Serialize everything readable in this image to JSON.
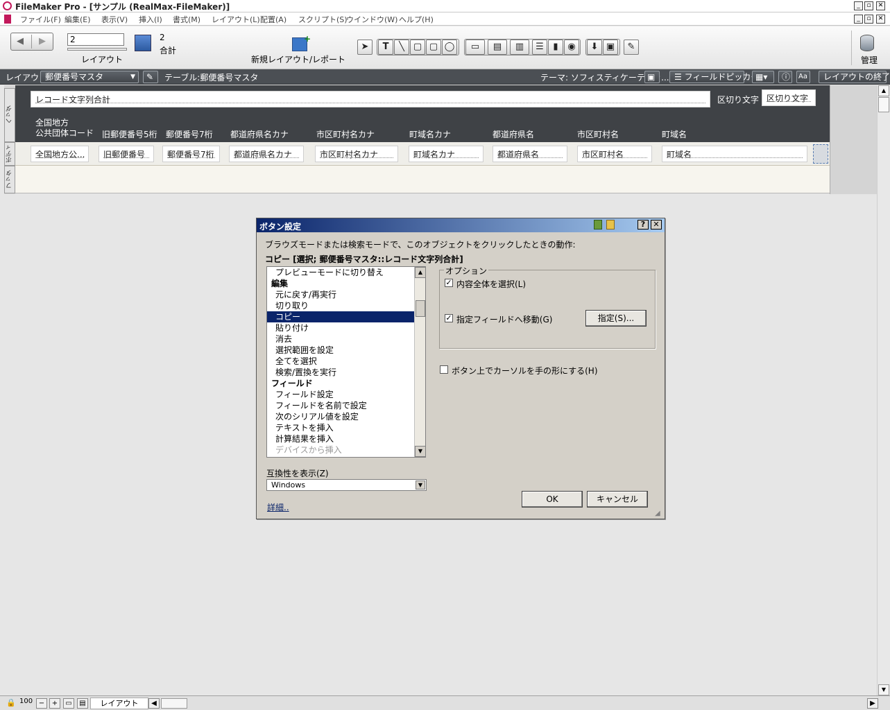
{
  "window": {
    "title": "FileMaker Pro - [サンプル (RealMax-FileMaker)]"
  },
  "menu": {
    "items": [
      "ファイル(F)",
      "編集(E)",
      "表示(V)",
      "挿入(I)",
      "書式(M)",
      "レイアウト(L)",
      "配置(A)",
      "スクリプト(S)",
      "ウインドウ(W)",
      "ヘルプ(H)"
    ]
  },
  "toolbar": {
    "layout_number": "2",
    "layout_label": "レイアウト",
    "total_count": "2",
    "total_label": "合計",
    "new_layout_label": "新規レイアウト/レポート",
    "manage_label": "管理"
  },
  "layoutbar": {
    "layout_prefix": "レイアウト:",
    "layout_name": "郵便番号マスタ",
    "table_label": "テーブル:郵便番号マスタ",
    "theme_label": "テーマ: ソフィスティケーティッ...",
    "field_picker_label": "フィールドピッカー",
    "exit_layout_label": "レイアウトの終了"
  },
  "parts": {
    "header_tab": "ヘッダ",
    "body_tab": "ボディ",
    "footer_tab": "フッタ"
  },
  "header": {
    "summary_field": "レコード文字列合計",
    "delimiter_label": "区切り文字",
    "delimiter_field": "区切り文字",
    "columns": [
      "全国地方\n公共団体コード",
      "旧郵便番号5桁",
      "郵便番号7桁",
      "都道府県名カナ",
      "市区町村名カナ",
      "町域名カナ",
      "都道府県名",
      "市区町村名",
      "町域名"
    ]
  },
  "body": {
    "fields": [
      "全国地方公...",
      "旧郵便番号",
      "郵便番号7桁",
      "都道府県名カナ",
      "市区町村名カナ",
      "町域名カナ",
      "都道府県名",
      "市区町村名",
      "町域名"
    ]
  },
  "dialog": {
    "title": "ボタン設定",
    "description": "ブラウズモードまたは検索モードで、このオブジェクトをクリックしたときの動作:",
    "current_action": "コピー [選択; 郵便番号マスタ::レコード文字列合計]",
    "list_items": [
      {
        "label": "プレビューモードに切り替え",
        "kind": "item"
      },
      {
        "label": "編集",
        "kind": "category"
      },
      {
        "label": "元に戻す/再実行",
        "kind": "item"
      },
      {
        "label": "切り取り",
        "kind": "item"
      },
      {
        "label": "コピー",
        "kind": "selected"
      },
      {
        "label": "貼り付け",
        "kind": "item"
      },
      {
        "label": "消去",
        "kind": "item"
      },
      {
        "label": "選択範囲を設定",
        "kind": "item"
      },
      {
        "label": "全てを選択",
        "kind": "item"
      },
      {
        "label": "検索/置換を実行",
        "kind": "item"
      },
      {
        "label": "フィールド",
        "kind": "category"
      },
      {
        "label": "フィールド設定",
        "kind": "item"
      },
      {
        "label": "フィールドを名前で設定",
        "kind": "item"
      },
      {
        "label": "次のシリアル値を設定",
        "kind": "item"
      },
      {
        "label": "テキストを挿入",
        "kind": "item"
      },
      {
        "label": "計算結果を挿入",
        "kind": "item"
      },
      {
        "label": "デバイスから挿入",
        "kind": "disabled"
      }
    ],
    "options_label": "オプション",
    "option_select_all": "内容全体を選択(L)",
    "option_go_field": "指定フィールドへ移動(G)",
    "specify_button": "指定(S)...",
    "hand_cursor_label": "ボタン上でカーソルを手の形にする(H)",
    "compat_label": "互換性を表示(Z)",
    "compat_value": "Windows",
    "details_link": "詳細..",
    "ok_button": "OK",
    "cancel_button": "キャンセル"
  },
  "statusbar": {
    "zoom": "100",
    "mode": "レイアウト"
  }
}
